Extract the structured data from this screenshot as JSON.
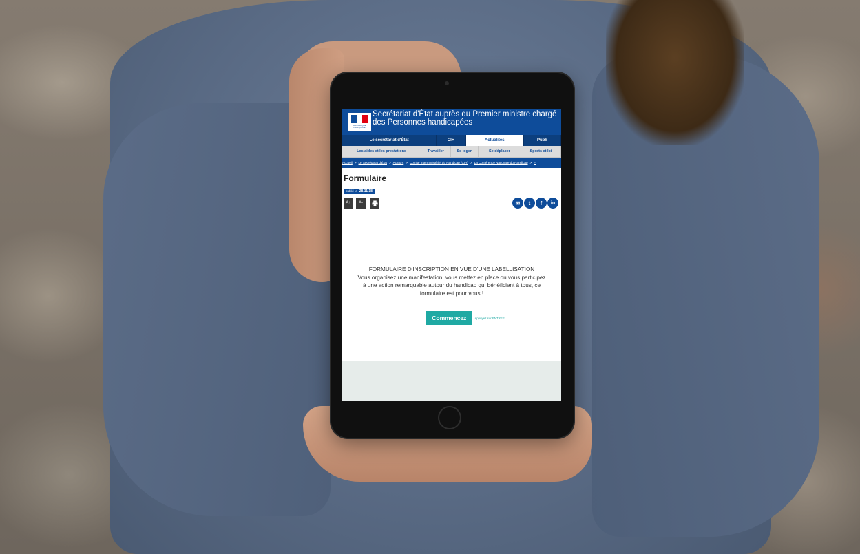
{
  "header": {
    "title": "Secrétariat d'État auprès du Premier ministre chargé des Personnes handicapées",
    "logo_caption": "RÉPUBLIQUE FRANÇAISE"
  },
  "main_nav": [
    "Le secrétariat d'État",
    "CIH",
    "Actualités",
    "Publi"
  ],
  "sub_nav": [
    "Les aides et les prestations",
    "Travailler",
    "Se loger",
    "Se déplacer",
    "Sports et loi"
  ],
  "breadcrumb": [
    "Accueil",
    "Le Secrétariat d'État",
    "Acteurs",
    "Comité Interministériel du Handicap (CIH)",
    "La Conférence Nationale du Handicap",
    "F"
  ],
  "page": {
    "title": "Formulaire",
    "published_label": "publié le",
    "published_date": "28.11.18",
    "font_increase": "A+",
    "font_decrease": "A-"
  },
  "share": {
    "mail": "✉",
    "twitter": "t",
    "facebook": "f",
    "linkedin": "in"
  },
  "form": {
    "heading": "FORMULAIRE D'INSCRIPTION EN VUE D'UNE LABELLISATION",
    "description": "Vous organisez une manifestation, vous mettez en place ou vous participez à une action remarquable autour du handicap qui bénéficient à tous, ce formulaire est pour vous !",
    "start_label": "Commencez",
    "enter_hint": "Appuyez sur ENTRÉE"
  },
  "colors": {
    "brand_blue": "#0e4c9a",
    "accent_teal": "#1fa9a3"
  }
}
